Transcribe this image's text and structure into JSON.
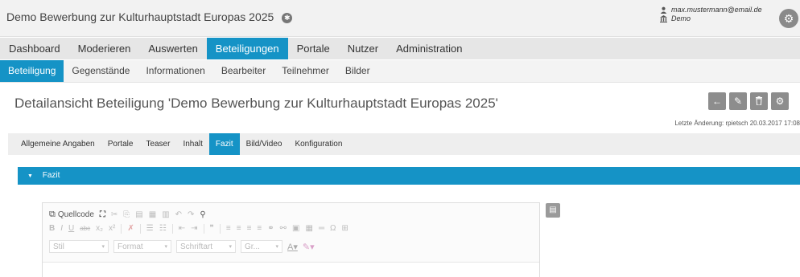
{
  "app": {
    "title": "Demo Bewerbung zur Kulturhauptstadt Europas 2025",
    "title_icon": "settings-small-icon"
  },
  "user": {
    "email": "max.mustermann@email.de",
    "org": "Demo"
  },
  "main_nav": [
    {
      "label": "Dashboard"
    },
    {
      "label": "Moderieren"
    },
    {
      "label": "Auswerten"
    },
    {
      "label": "Beteiligungen"
    },
    {
      "label": "Portale"
    },
    {
      "label": "Nutzer"
    },
    {
      "label": "Administration"
    }
  ],
  "sub_nav": [
    {
      "label": "Beteiligung"
    },
    {
      "label": "Gegenstände"
    },
    {
      "label": "Informationen"
    },
    {
      "label": "Bearbeiter"
    },
    {
      "label": "Teilnehmer"
    },
    {
      "label": "Bilder"
    }
  ],
  "page": {
    "title": "Detailansicht Beteiligung 'Demo Bewerbung zur Kulturhauptstadt Europas 2025'",
    "last_change": "Letzte Änderung: rpietsch 20.03.2017 17:08"
  },
  "action_icons": [
    "back-icon",
    "edit-icon",
    "delete-icon",
    "settings-icon"
  ],
  "tabs": [
    {
      "label": "Allgemeine Angaben"
    },
    {
      "label": "Portale"
    },
    {
      "label": "Teaser"
    },
    {
      "label": "Inhalt"
    },
    {
      "label": "Fazit"
    },
    {
      "label": "Bild/Video"
    },
    {
      "label": "Konfiguration"
    }
  ],
  "section": {
    "label": "Fazit"
  },
  "editor": {
    "source_label": "Quellcode",
    "style_combo": "Stil",
    "format_combo": "Format",
    "font_combo": "Schriftart",
    "size_combo": "Gr..."
  },
  "theme": {
    "accent": "#1593c6"
  }
}
